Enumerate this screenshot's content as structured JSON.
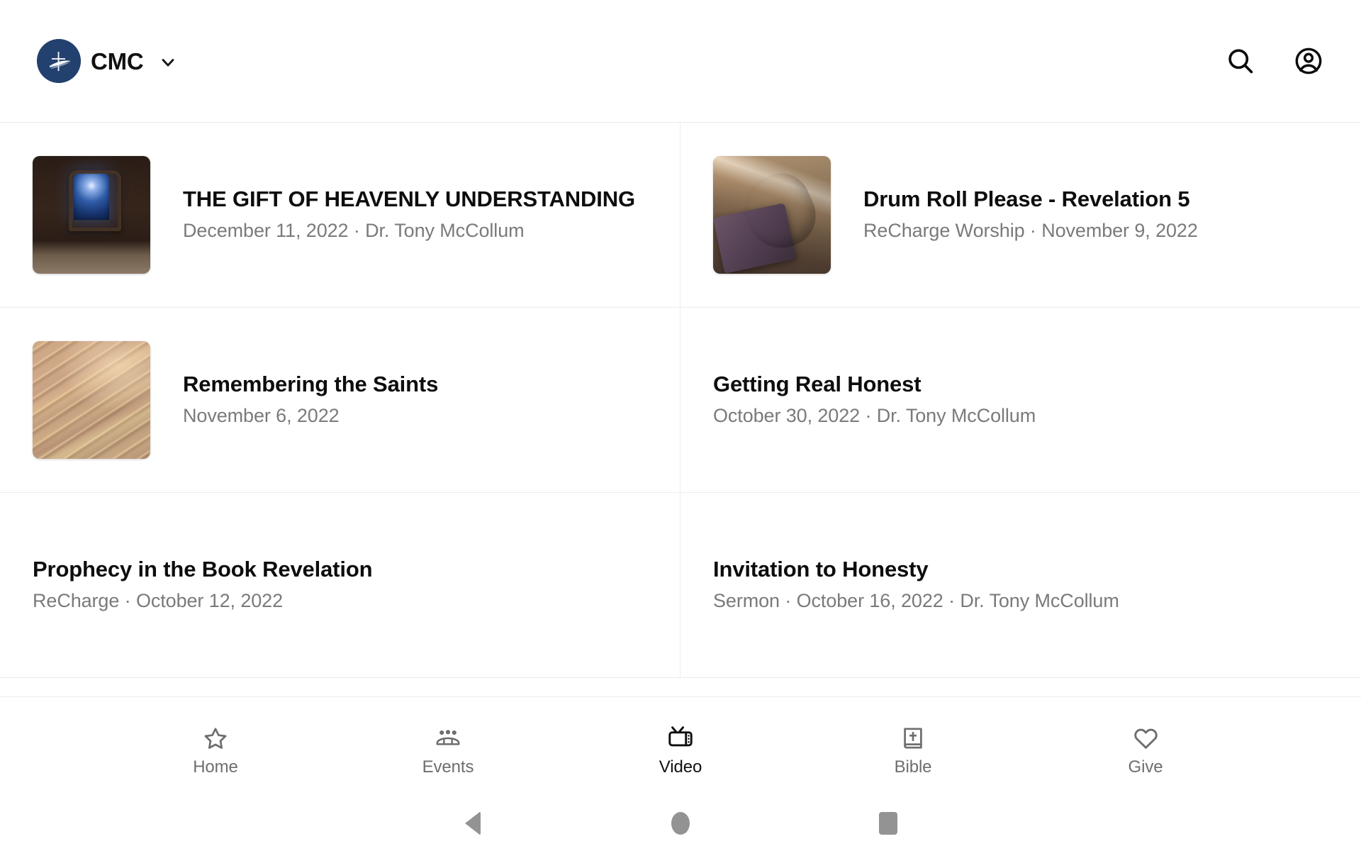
{
  "header": {
    "brand_name": "CMC",
    "logo_icon": "church-cross-swoosh-logo",
    "caret_icon": "chevron-down-icon",
    "logo_color": "#23416e",
    "actions": [
      {
        "name": "search-icon",
        "label": "Search"
      },
      {
        "name": "account-circle-icon",
        "label": "Account"
      }
    ]
  },
  "videos": [
    {
      "title": "THE GIFT OF HEAVENLY UNDERSTANDING",
      "meta": "December 11, 2022 · Dr. Tony McCollum",
      "thumbnail": "moonlit-window-stone-wall",
      "has_thumbnail": true
    },
    {
      "title": "Drum Roll Please - Revelation 5",
      "meta": "ReCharge Worship · November 9, 2022",
      "thumbnail": "praying-hands-on-bible",
      "has_thumbnail": true
    },
    {
      "title": "Remembering the Saints",
      "meta": "November 6, 2022",
      "thumbnail": "golden-abstract-streaks",
      "has_thumbnail": true
    },
    {
      "title": "Getting Real Honest",
      "meta": "October 30, 2022 · Dr. Tony McCollum",
      "thumbnail": "",
      "has_thumbnail": false
    },
    {
      "title": "Prophecy in the Book Revelation",
      "meta": "ReCharge · October 12, 2022",
      "thumbnail": "",
      "has_thumbnail": false
    },
    {
      "title": "Invitation to Honesty",
      "meta": "Sermon · October 16, 2022 · Dr. Tony McCollum",
      "thumbnail": "",
      "has_thumbnail": false
    }
  ],
  "tabbar": {
    "active": "Video",
    "tabs": [
      {
        "label": "Home",
        "icon": "star-outline-icon",
        "active": false
      },
      {
        "label": "Events",
        "icon": "people-group-icon",
        "active": false
      },
      {
        "label": "Video",
        "icon": "television-icon",
        "active": true
      },
      {
        "label": "Bible",
        "icon": "book-cross-icon",
        "active": false
      },
      {
        "label": "Give",
        "icon": "heart-outline-icon",
        "active": false
      }
    ]
  },
  "system_nav": {
    "buttons": [
      {
        "name": "android-back-button",
        "icon": "triangle-left-icon"
      },
      {
        "name": "android-home-button",
        "icon": "circle-icon"
      },
      {
        "name": "android-recents-button",
        "icon": "square-icon"
      }
    ]
  }
}
